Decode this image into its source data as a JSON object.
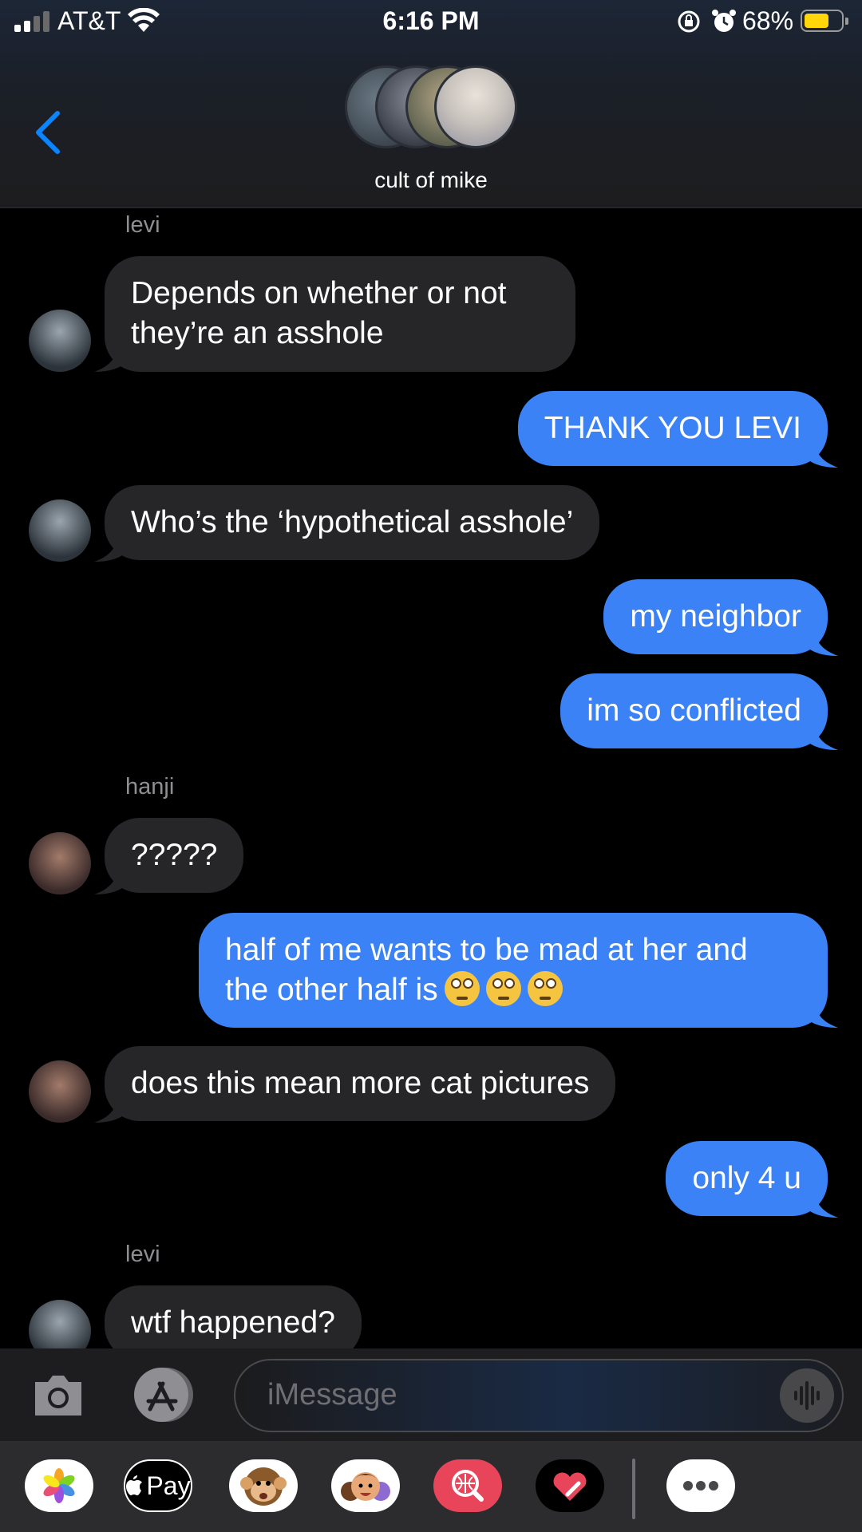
{
  "status_bar": {
    "carrier": "AT&T",
    "time": "6:16 PM",
    "battery_percent": "68%",
    "battery_level": 0.68
  },
  "conversation": {
    "group_name": "cult of mike"
  },
  "messages": [
    {
      "type": "sender",
      "name": "levi"
    },
    {
      "type": "in",
      "text": "Depends on whether or not\nthey’re an asshole"
    },
    {
      "type": "out",
      "text": "THANK YOU LEVI"
    },
    {
      "type": "in",
      "text": "Who’s the ‘hypothetical asshole’"
    },
    {
      "type": "out",
      "text": "my neighbor"
    },
    {
      "type": "out",
      "text": "im so conflicted"
    },
    {
      "type": "sender",
      "name": "hanji"
    },
    {
      "type": "in",
      "text": "?????"
    },
    {
      "type": "out",
      "text": "half of me wants to be mad at her and\nthe other half is",
      "emoji": "flushed-face-emoji ×3"
    },
    {
      "type": "in",
      "text": "does this mean more cat pictures"
    },
    {
      "type": "out",
      "text": "only 4 u"
    },
    {
      "type": "sender",
      "name": "levi"
    },
    {
      "type": "in",
      "text": "wtf happened?"
    }
  ],
  "composer": {
    "placeholder": "iMessage"
  },
  "app_drawer": {
    "apple_pay_label": "Pay"
  },
  "colors": {
    "outgoing_bubble": "#3b82f6",
    "incoming_bubble": "#262628",
    "accent": "#0a84ff"
  }
}
